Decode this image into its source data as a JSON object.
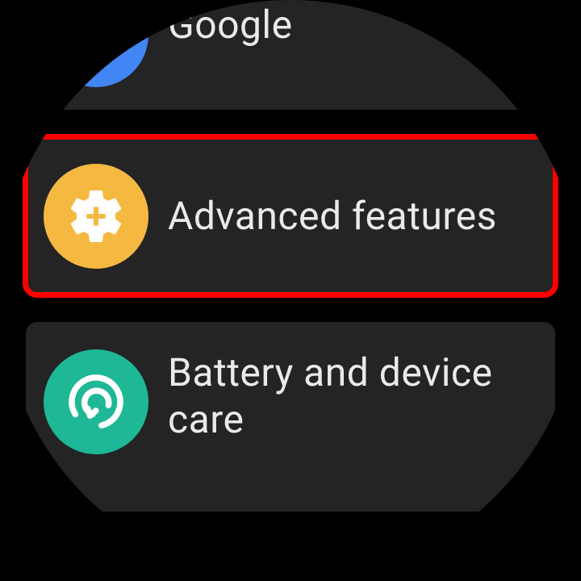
{
  "settings": {
    "items": [
      {
        "label": "Google",
        "icon": "google-icon",
        "iconColor": "#4285f4"
      },
      {
        "label": "Advanced features",
        "icon": "gear-plus-icon",
        "iconColor": "#f5b942",
        "highlighted": true
      },
      {
        "label": "Battery and device care",
        "icon": "refresh-circle-icon",
        "iconColor": "#1eb896"
      }
    ]
  },
  "colors": {
    "background": "#000000",
    "itemBackground": "#242424",
    "textColor": "#eaeaea",
    "highlightBorder": "#ff0000"
  }
}
